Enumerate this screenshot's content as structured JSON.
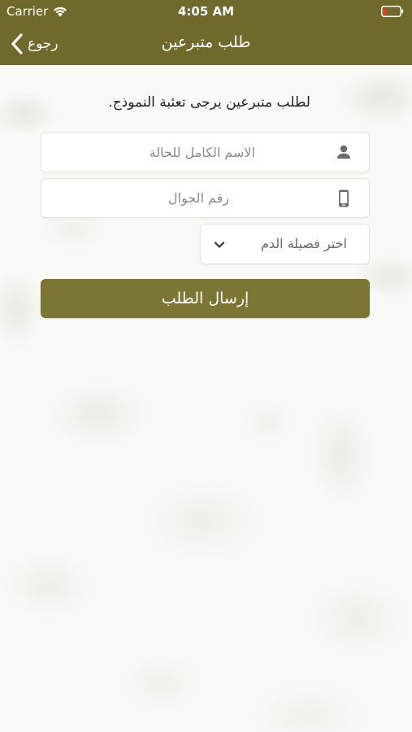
{
  "status_bar": {
    "carrier": "Carrier",
    "time": "4:05 AM"
  },
  "nav": {
    "title": "طلب متبرعين",
    "back_label": "رجوع"
  },
  "form": {
    "intro": "لطلب متبرعين يرجى تعئبة النموذج.",
    "name_placeholder": "الاسم الكامل للحالة",
    "phone_placeholder": "رقم الجوال",
    "blood_type_value": "اختر فصيلة الدم",
    "submit_label": "إرسال الطلب"
  },
  "colors": {
    "accent": "#6f6a2c",
    "button": "#7b7634"
  },
  "icons": {
    "name_field": "person-icon",
    "phone_field": "mobile-phone-icon",
    "blood_select": "chevron-down-icon",
    "back": "chevron-left-icon"
  }
}
